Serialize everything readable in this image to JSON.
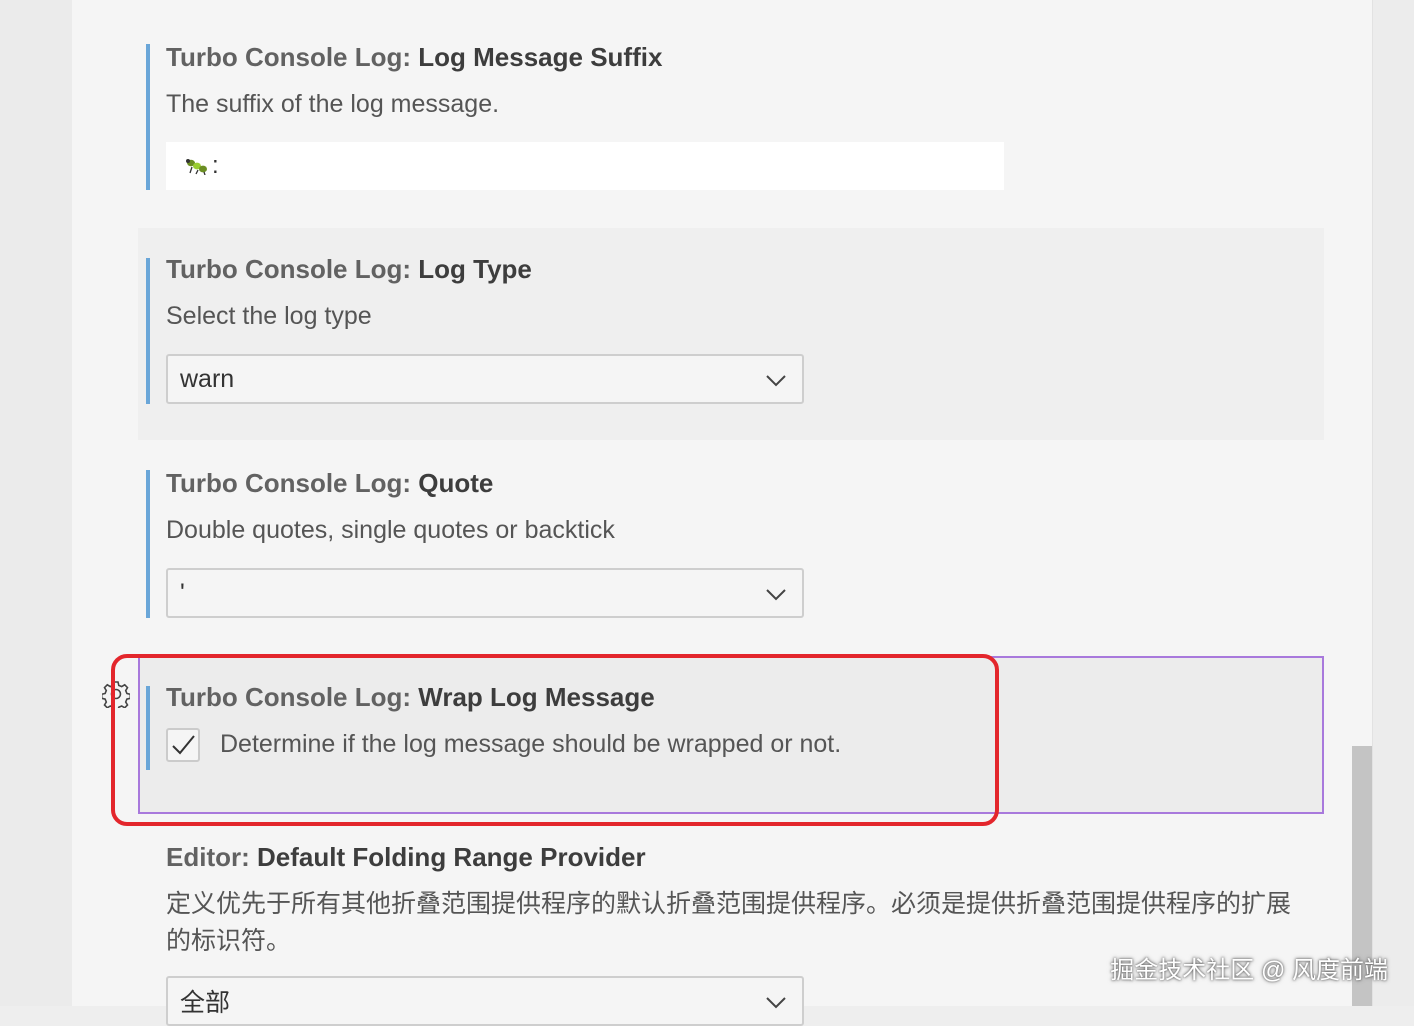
{
  "settings": [
    {
      "category": "Turbo Console Log: ",
      "name": "Log Message Suffix",
      "description": "The suffix of the log message.",
      "control": "text",
      "value": ":",
      "value_icon": "bug-emoji-icon"
    },
    {
      "category": "Turbo Console Log: ",
      "name": "Log Type",
      "description": "Select the log type",
      "control": "select",
      "value": "warn"
    },
    {
      "category": "Turbo Console Log: ",
      "name": "Quote",
      "description": "Double quotes, single quotes or backtick",
      "control": "select",
      "value": "'"
    },
    {
      "category": "Turbo Console Log: ",
      "name": "Wrap Log Message",
      "description": "Determine if the log message should be wrapped or not.",
      "control": "checkbox",
      "checked": true
    },
    {
      "category": "Editor: ",
      "name": "Default Folding Range Provider",
      "description": "定义优先于所有其他折叠范围提供程序的默认折叠范围提供程序。必须是提供折叠范围提供程序的扩展的标识符。",
      "control": "select",
      "value": "全部"
    }
  ],
  "watermark": "掘金技术社区 @ 风度前端",
  "colors": {
    "modified_indicator": "#6aa6d8",
    "focus_border": "#a879dc",
    "annotation_red": "#e3262c"
  }
}
